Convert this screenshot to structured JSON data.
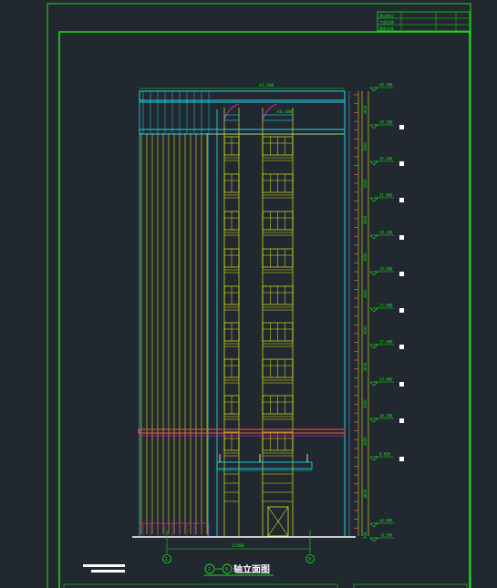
{
  "colors": {
    "background": "#212830",
    "frame": "#19e019",
    "cyan": "#22d3e6",
    "yellow": "#e6e619",
    "magenta": "#e619b4",
    "red": "#ff5050",
    "white": "#ffffff"
  },
  "drawing": {
    "title": "轴立面图",
    "axis_start": "1",
    "axis_end": "9",
    "overall_width": "13200",
    "roof_level": "43.500",
    "parapet_level": "40.200"
  },
  "title_block": {
    "rows": [
      "建设单位",
      "工程名称",
      "图纸名称"
    ]
  },
  "elevation_marks": [
    "40.500",
    "38.500",
    "35.400",
    "31.800",
    "28.200",
    "24.600",
    "21.000",
    "17.400",
    "13.800",
    "10.200",
    "6.600",
    "±0.000",
    "-0.300"
  ],
  "floor_dims": [
    "3600",
    "3600",
    "3600",
    "3600",
    "3600",
    "3600",
    "3600",
    "3600",
    "3600",
    "3600",
    "4800",
    "900"
  ]
}
